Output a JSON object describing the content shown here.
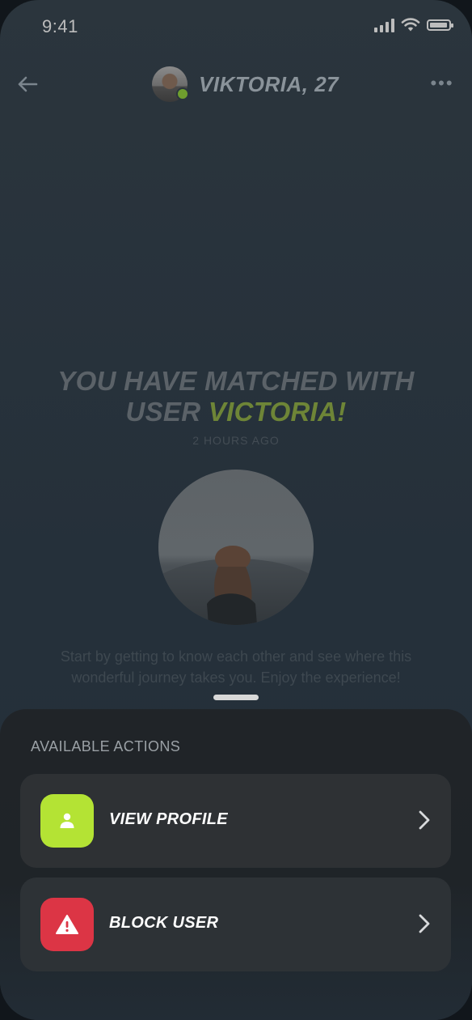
{
  "status_bar": {
    "time": "9:41"
  },
  "header": {
    "name": "VIKTORIA, 27"
  },
  "match": {
    "title_line1": "YOU HAVE MATCHED WITH",
    "title_line2_prefix": "USER ",
    "title_highlight": "VICTORIA!",
    "time_ago": "2 HOURS AGO",
    "body": "Start by getting to know each other and see where this wonderful journey takes you. Enjoy the experience!"
  },
  "sheet": {
    "title": "AVAILABLE ACTIONS",
    "actions": [
      {
        "label": "VIEW PROFILE"
      },
      {
        "label": "BLOCK USER"
      }
    ]
  },
  "colors": {
    "accent_green": "#b4e334",
    "danger_red": "#dc3545",
    "highlight_green": "#6e8537"
  }
}
